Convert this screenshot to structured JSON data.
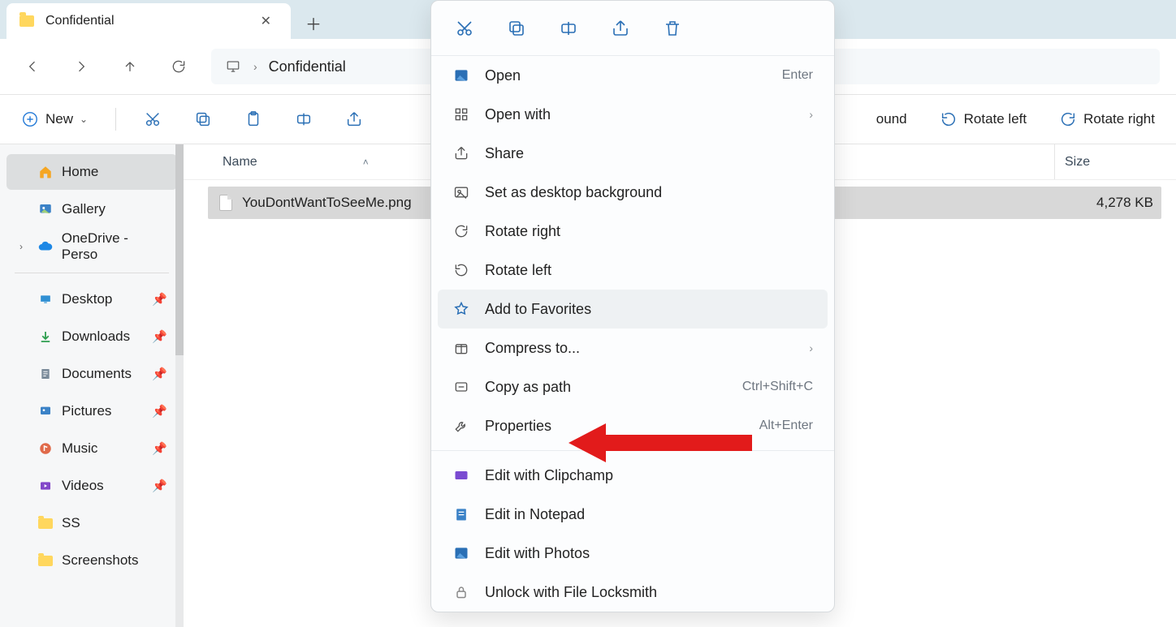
{
  "tab": {
    "title": "Confidential"
  },
  "address": {
    "folder": "Confidential"
  },
  "toolbar": {
    "new": "New",
    "set_bg": "ound",
    "rotate_left": "Rotate left",
    "rotate_right": "Rotate right"
  },
  "columns": {
    "name": "Name",
    "size": "Size"
  },
  "file": {
    "name": "YouDontWantToSeeMe.png",
    "size": "4,278 KB"
  },
  "sidebar": {
    "home": "Home",
    "gallery": "Gallery",
    "onedrive": "OneDrive - Perso",
    "desktop": "Desktop",
    "downloads": "Downloads",
    "documents": "Documents",
    "pictures": "Pictures",
    "music": "Music",
    "videos": "Videos",
    "ss": "SS",
    "screenshots": "Screenshots"
  },
  "ctx": {
    "open": "Open",
    "open_sc": "Enter",
    "openwith": "Open with",
    "share": "Share",
    "setbg": "Set as desktop background",
    "rright": "Rotate right",
    "rleft": "Rotate left",
    "fav": "Add to Favorites",
    "compress": "Compress to...",
    "copypath": "Copy as path",
    "copypath_sc": "Ctrl+Shift+C",
    "props": "Properties",
    "props_sc": "Alt+Enter",
    "clipchamp": "Edit with Clipchamp",
    "notepad": "Edit in Notepad",
    "photos": "Edit with Photos",
    "locksmith": "Unlock with File Locksmith"
  }
}
